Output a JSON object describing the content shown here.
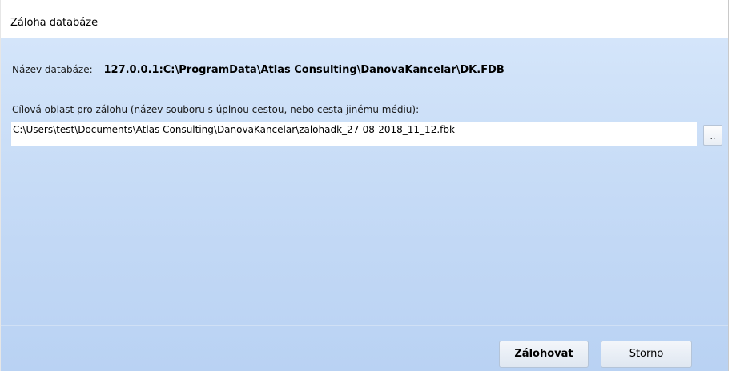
{
  "window": {
    "title": "Záloha databáze"
  },
  "database": {
    "label": "Název databáze:",
    "value": "127.0.0.1:C:\\ProgramData\\Atlas Consulting\\DanovaKancelar\\DK.FDB"
  },
  "target": {
    "label": "Cílová oblast pro zálohu (název souboru s úplnou cestou, nebo cesta jinému médiu):",
    "path_value": "C:\\Users\\test\\Documents\\Atlas Consulting\\DanovaKancelar\\zalohadk_27-08-2018_11_12.fbk",
    "browse_label": ".."
  },
  "buttons": {
    "backup_label": "Zálohovat",
    "cancel_label": "Storno"
  }
}
